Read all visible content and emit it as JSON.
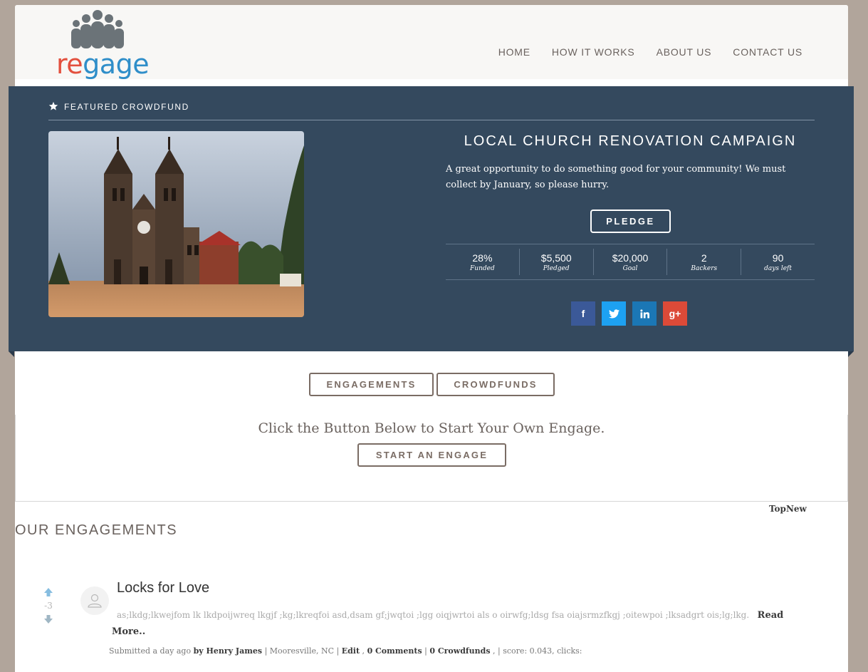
{
  "logo": {
    "text_re": "re",
    "text_gage": "gage",
    "icon": "people-group-icon",
    "color_re": "#e3503e",
    "color_gage": "#2f8ec9"
  },
  "nav": {
    "home": "HOME",
    "how_it_works": "HOW IT WORKS",
    "about_us": "ABOUT US",
    "contact_us": "CONTACT US"
  },
  "featured": {
    "heading": "FEATURED CROWDFUND",
    "title": "LOCAL CHURCH RENOVATION CAMPAIGN",
    "description": "A great opportunity to do something good for your community! We must collect by January, so please hurry.",
    "pledge_label": "PLEDGE",
    "stats": [
      {
        "value": "28%",
        "label": "Funded"
      },
      {
        "value": "$5,500",
        "label": "Pledged"
      },
      {
        "value": "$20,000",
        "label": "Goal"
      },
      {
        "value": "2",
        "label": "Backers"
      },
      {
        "value": "90",
        "label": "days left"
      }
    ],
    "social": {
      "facebook": "f",
      "google": "g+"
    },
    "bg_color": "#34495e"
  },
  "tabs": {
    "engagements": "ENGAGEMENTS",
    "crowdfunds": "CROWDFUNDS"
  },
  "cta": {
    "text": "Click the Button Below to Start Your Own Engage.",
    "button": "START AN ENGAGE"
  },
  "sort": {
    "top": "Top",
    "new": "New"
  },
  "section_title": "OUR ENGAGEMENTS",
  "posts": [
    {
      "vote_count": "-3",
      "title": "Locks for Love",
      "body": "as;lkdg;lkwejfom lk lkdpoijwreq lkgjf ;kg;lkreqfoi asd,dsam gf;jwqtoi ;lgg oiqjwrtoi als o oirwfg;ldsg fsa oiajsrmzfkgj ;oitewpoi ;lksadgrt ois;lg;lkg.",
      "read_more": "Read More..",
      "submitted": "Submitted a day ago",
      "author": "by Henry James",
      "location": "Mooresville, NC",
      "edit": "Edit",
      "comments": "0 Comments",
      "crowdfunds": "0 Crowdfunds",
      "score": "score: 0.043, clicks:"
    }
  ]
}
